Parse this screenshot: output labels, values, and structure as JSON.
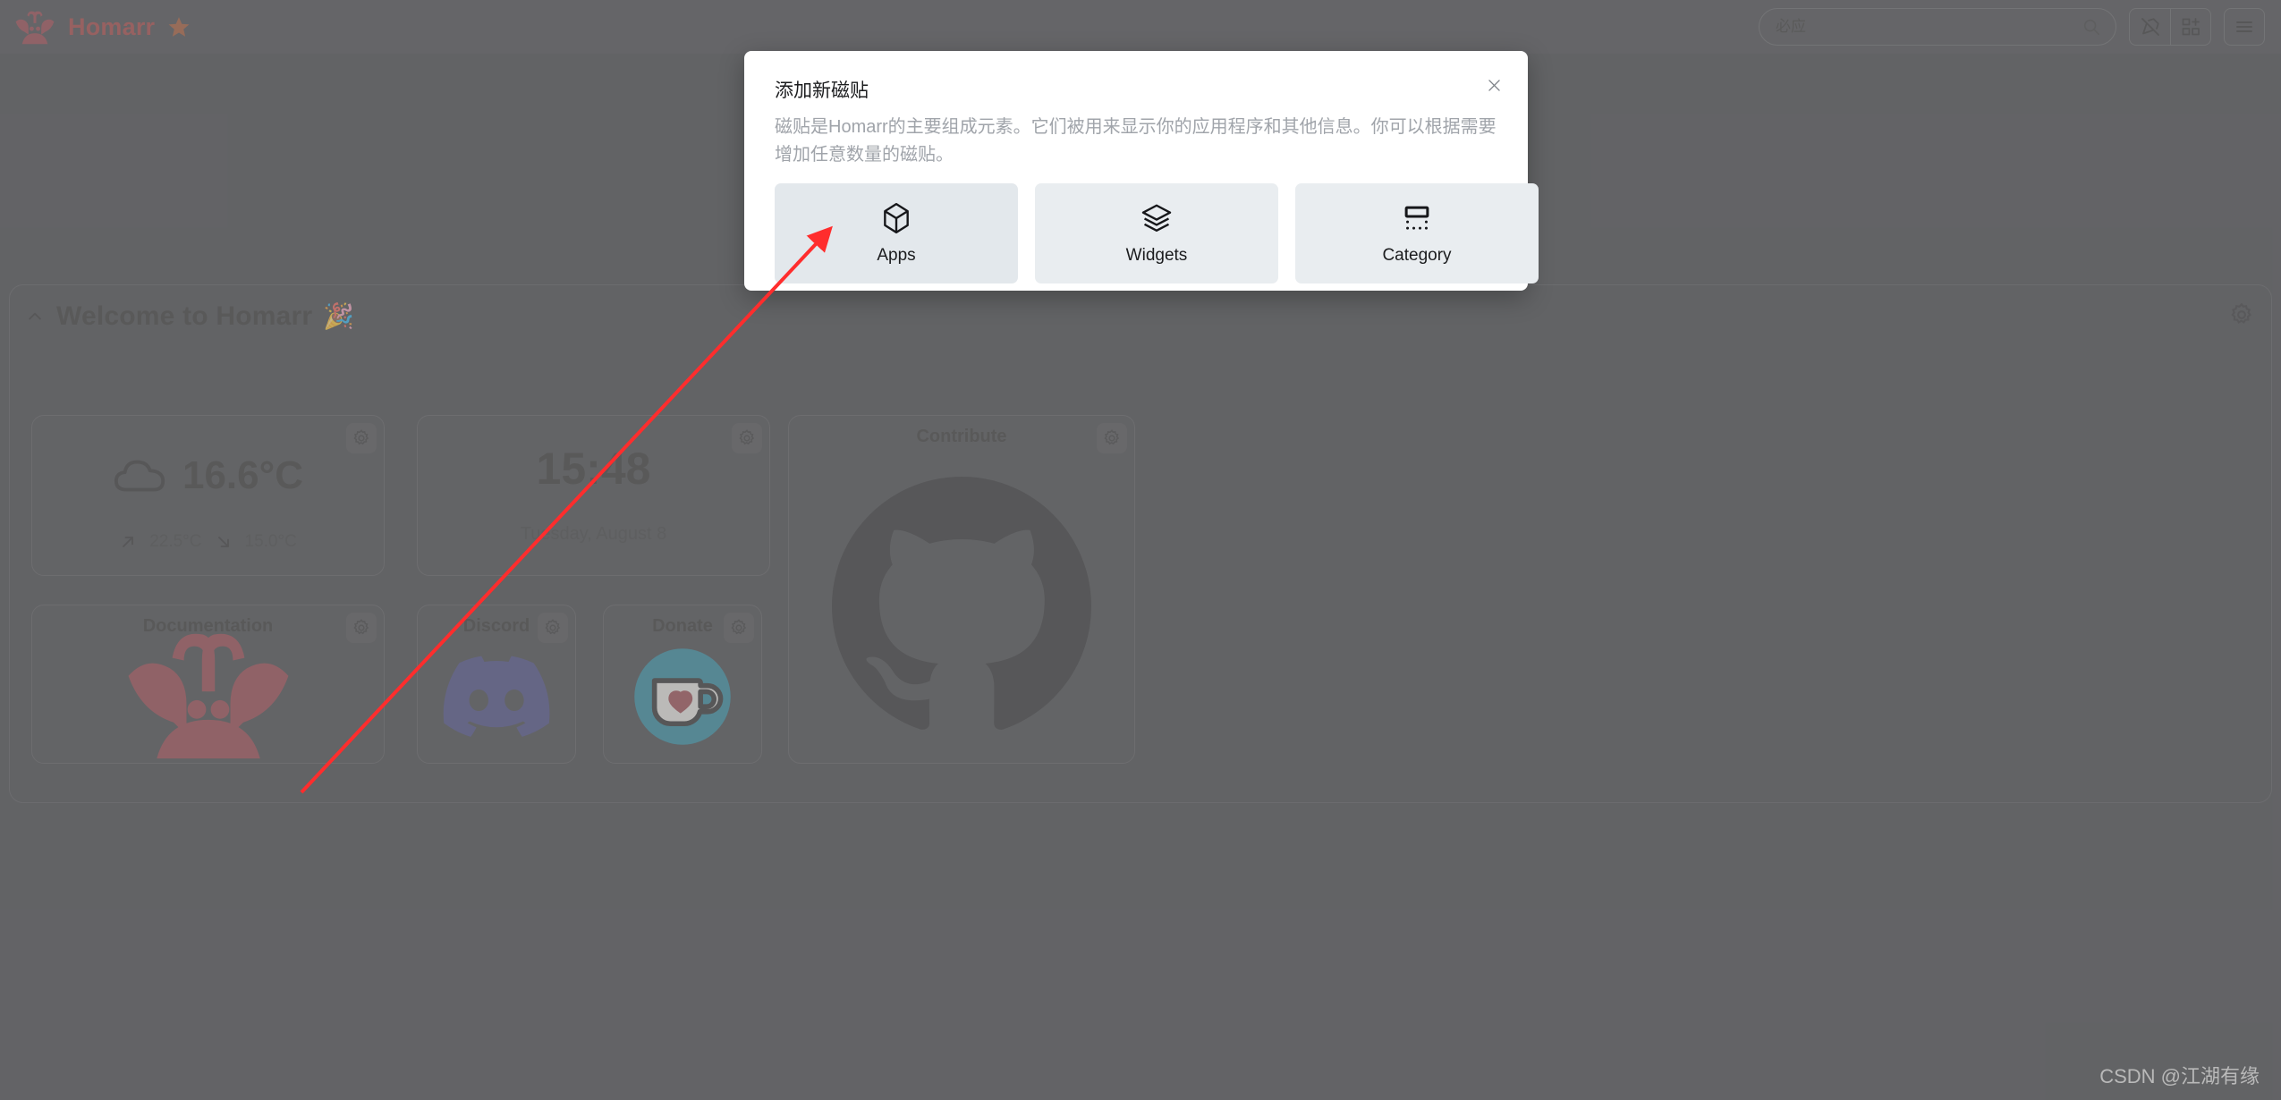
{
  "header": {
    "brand_name": "Homarr",
    "brand_logo_icon": "homarr-lobster-logo",
    "brand_star_icon": "star-icon",
    "search": {
      "placeholder": "必应",
      "value": "",
      "icon": "search-icon"
    },
    "buttons": [
      {
        "name": "edit-mode-off-button",
        "icon": "pencil-off-icon",
        "label": ""
      },
      {
        "name": "add-tile-button",
        "icon": "layout-grid-add-icon",
        "label": ""
      },
      {
        "name": "menu-button",
        "icon": "hamburger-menu-icon",
        "label": ""
      }
    ]
  },
  "board": {
    "section": {
      "title": "Welcome to Homarr",
      "emoji": "🎉",
      "collapse_icon": "chevron-up-icon",
      "settings_icon": "gear-icon"
    },
    "weather": {
      "name": "weather-widget",
      "icon": "cloud-icon",
      "temperature": "16.6°C",
      "max_icon": "arrow-up-right-icon",
      "max_temp": "22.5°C",
      "min_icon": "arrow-down-right-icon",
      "min_temp": "15.0°C",
      "settings_icon": "gear-icon"
    },
    "clock": {
      "name": "clock-widget",
      "time": "15:48",
      "date": "Tuesday, August 8",
      "settings_icon": "gear-icon"
    },
    "apps": [
      {
        "name": "contribute-tile",
        "title": "Contribute",
        "icon": "github-octocat-logo"
      },
      {
        "name": "documentation-tile",
        "title": "Documentation",
        "icon": "homarr-lobster-logo"
      },
      {
        "name": "discord-tile",
        "title": "Discord",
        "icon": "discord-logo"
      },
      {
        "name": "donate-tile",
        "title": "Donate",
        "icon": "kofi-cup-logo"
      }
    ]
  },
  "modal": {
    "title": "添加新磁贴",
    "description": "磁贴是Homarr的主要组成元素。它们被用来显示你的应用程序和其他信息。你可以根据需要增加任意数量的磁贴。",
    "close_icon": "close-icon",
    "options": [
      {
        "name": "option-apps",
        "label": "Apps",
        "icon": "box-3d-icon",
        "selected": true
      },
      {
        "name": "option-widgets",
        "label": "Widgets",
        "icon": "layers-stack-icon",
        "selected": false
      },
      {
        "name": "option-category",
        "label": "Category",
        "icon": "category-rectangle-dots-icon",
        "selected": false
      }
    ]
  },
  "annotation": {
    "arrow_color": "#ff2d2d",
    "arrow_icon": "red-pointer-arrow"
  },
  "watermark": "CSDN @江湖有缘"
}
